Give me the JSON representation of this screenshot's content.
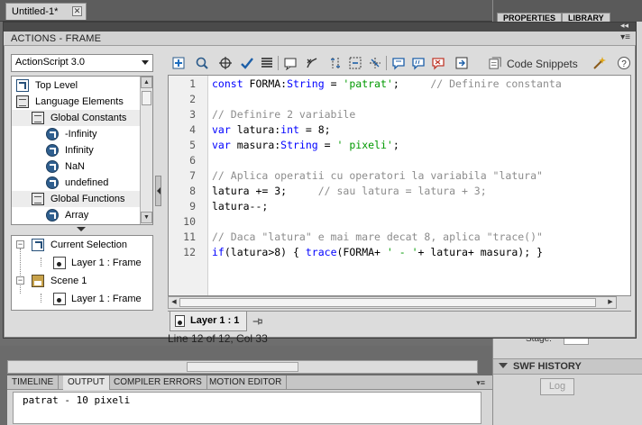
{
  "document": {
    "tab_title": "Untitled-1*",
    "close_glyph": "✕"
  },
  "right_panel": {
    "tabs": [
      "PROPERTIES",
      "LIBRARY"
    ],
    "stage_label": "Stage:",
    "section_title": "SWF HISTORY",
    "log_button": "Log"
  },
  "actions_panel": {
    "title": "ACTIONS - FRAME",
    "grip_glyph": "◂◂",
    "menu_glyph": "▾≡",
    "language_select": "ActionScript 3.0",
    "toolbox_tree": [
      {
        "label": "Top Level",
        "icon": "arrow-icon",
        "level": 0
      },
      {
        "label": "Language Elements",
        "icon": "book-icon",
        "level": 0
      },
      {
        "label": "Global Constants",
        "icon": "book-icon",
        "level": 1
      },
      {
        "label": "-Infinity",
        "icon": "circle-arrow-icon",
        "level": 2
      },
      {
        "label": "Infinity",
        "icon": "circle-arrow-icon",
        "level": 2
      },
      {
        "label": "NaN",
        "icon": "circle-arrow-icon",
        "level": 2
      },
      {
        "label": "undefined",
        "icon": "circle-arrow-icon",
        "level": 2
      },
      {
        "label": "Global Functions",
        "icon": "book-icon",
        "level": 1
      },
      {
        "label": "Array",
        "icon": "circle-arrow-icon",
        "level": 2
      }
    ],
    "script_navigator": [
      {
        "label": "Current Selection",
        "icon": "selection-icon"
      },
      {
        "label": "Layer 1 : Frame",
        "icon": "frame-icon"
      },
      {
        "label": "Scene 1",
        "icon": "scene-icon"
      },
      {
        "label": "Layer 1 : Frame",
        "icon": "frame-icon"
      }
    ],
    "code_snippets_label": "Code Snippets",
    "code_lines": [
      {
        "no": "1",
        "segments": [
          [
            "kw",
            "const"
          ],
          [
            "plain",
            " FORMA:"
          ],
          [
            "cls",
            "String"
          ],
          [
            "plain",
            " = "
          ],
          [
            "str",
            "'patrat'"
          ],
          [
            "plain",
            ";     "
          ],
          [
            "cm",
            "// Definire constanta"
          ]
        ]
      },
      {
        "no": "2",
        "segments": []
      },
      {
        "no": "3",
        "segments": [
          [
            "cm",
            "// Definire 2 variabile"
          ]
        ]
      },
      {
        "no": "4",
        "segments": [
          [
            "kw",
            "var"
          ],
          [
            "plain",
            " latura:"
          ],
          [
            "cls",
            "int"
          ],
          [
            "plain",
            " = 8;"
          ]
        ]
      },
      {
        "no": "5",
        "segments": [
          [
            "kw",
            "var"
          ],
          [
            "plain",
            " masura:"
          ],
          [
            "cls",
            "String"
          ],
          [
            "plain",
            " = "
          ],
          [
            "str",
            "' pixeli'"
          ],
          [
            "plain",
            ";"
          ]
        ]
      },
      {
        "no": "6",
        "segments": []
      },
      {
        "no": "7",
        "segments": [
          [
            "cm",
            "// Aplica operatii cu operatori la variabila \"latura\""
          ]
        ]
      },
      {
        "no": "8",
        "segments": [
          [
            "plain",
            "latura += 3;     "
          ],
          [
            "cm",
            "// sau latura = latura + 3;"
          ]
        ]
      },
      {
        "no": "9",
        "segments": [
          [
            "plain",
            "latura--;"
          ]
        ]
      },
      {
        "no": "10",
        "segments": []
      },
      {
        "no": "11",
        "segments": [
          [
            "cm",
            "// Daca \"latura\" e mai mare decat 8, aplica \"trace()\""
          ]
        ]
      },
      {
        "no": "12",
        "segments": [
          [
            "kw",
            "if"
          ],
          [
            "plain",
            "(latura>8) { "
          ],
          [
            "kw",
            "trace"
          ],
          [
            "plain",
            "(FORMA+ "
          ],
          [
            "str",
            "' - '"
          ],
          [
            "plain",
            "+ latura+ masura); }"
          ]
        ]
      }
    ],
    "script_tab": "Layer 1 : 1",
    "status": "Line 12 of 12, Col 33"
  },
  "bottom_panel": {
    "tabs": [
      "TIMELINE",
      "OUTPUT",
      "COMPILER ERRORS",
      "MOTION EDITOR"
    ],
    "active_tab": "OUTPUT",
    "menu_glyph": "▾≡",
    "output_text": "patrat - 10 pixeli"
  },
  "colors": {
    "keyword": "#0000ff",
    "string": "#009900",
    "comment": "#8c8c8c",
    "chrome": "#dcdcdc"
  }
}
